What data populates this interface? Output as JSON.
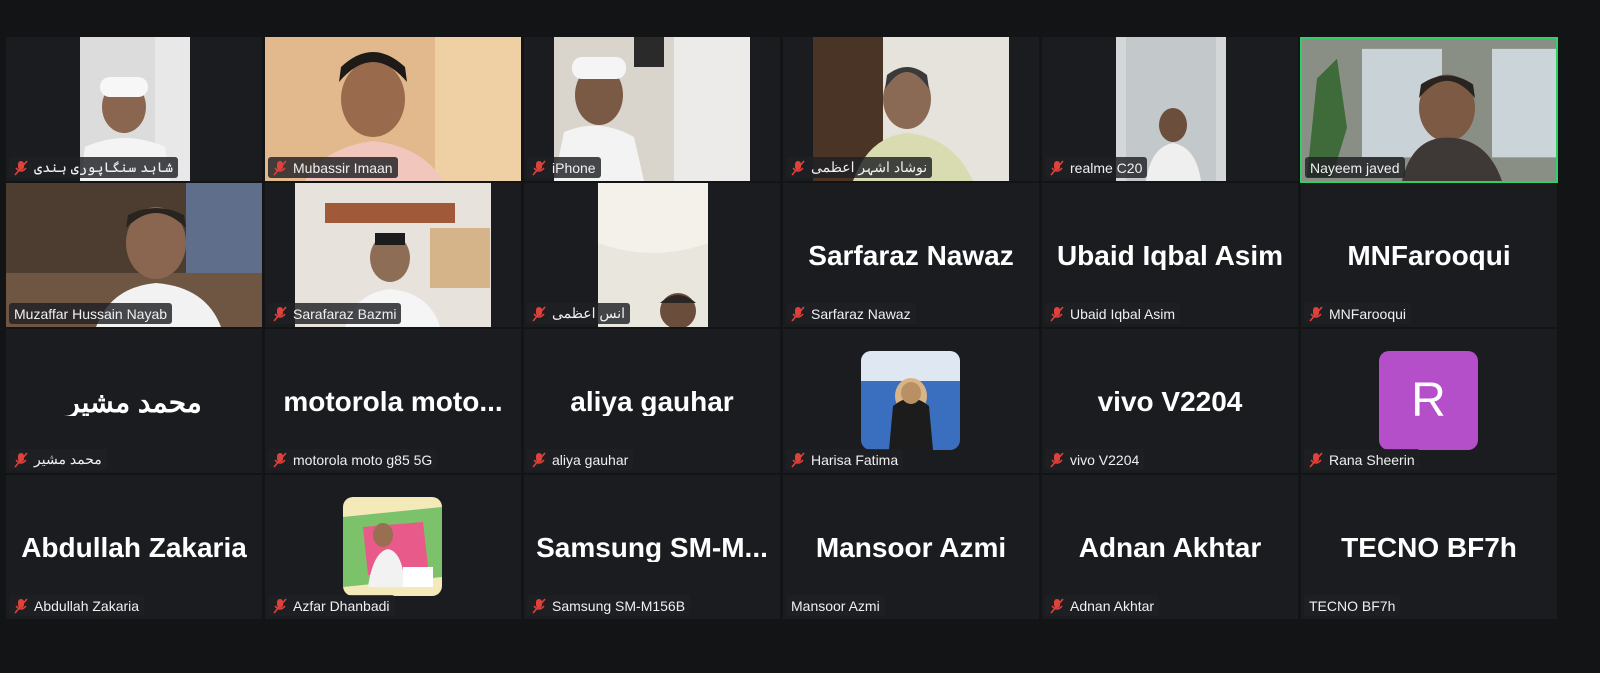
{
  "participants": [
    {
      "name": "شاہد سنگاپوری ہندی",
      "muted": true
    },
    {
      "name": "Mubassir Imaan",
      "muted": true
    },
    {
      "name": "iPhone",
      "muted": true
    },
    {
      "name": "نوشاد اشہر اعظمی",
      "muted": true
    },
    {
      "name": "realme C20",
      "muted": true
    },
    {
      "name": "Nayeem javed",
      "muted": false,
      "active_speaker": true
    },
    {
      "name": "Muzaffar Hussain Nayab",
      "muted": false
    },
    {
      "name": "Sarafaraz Bazmi",
      "muted": true
    },
    {
      "name": "انس اعظمی",
      "muted": true
    },
    {
      "name": "Sarfaraz Nawaz",
      "display": "Sarfaraz Nawaz",
      "muted": true
    },
    {
      "name": "Ubaid Iqbal Asim",
      "display": "Ubaid Iqbal Asim",
      "muted": true
    },
    {
      "name": "MNFarooqui",
      "display": "MNFarooqui",
      "muted": true
    },
    {
      "name": "محمد مشیر",
      "display": "محمد مشیر",
      "muted": true
    },
    {
      "name": "motorola moto g85 5G",
      "display": "motorola  moto...",
      "muted": true
    },
    {
      "name": "aliya gauhar",
      "display": "aliya gauhar",
      "muted": true
    },
    {
      "name": "Harisa Fatima",
      "muted": true,
      "avatar": "profile-photo"
    },
    {
      "name": "vivo V2204",
      "display": "vivo V2204",
      "muted": true
    },
    {
      "name": "Rana Sheerin",
      "muted": true,
      "letter": "R",
      "letter_color": "#b44ec9"
    },
    {
      "name": "Abdullah Zakaria",
      "display": "Abdullah Zakaria",
      "muted": true
    },
    {
      "name": "Azfar Dhanbadi",
      "muted": true,
      "avatar": "profile-photo"
    },
    {
      "name": "Samsung SM-M156B",
      "display": "Samsung  SM-M...",
      "muted": true
    },
    {
      "name": "Mansoor Azmi",
      "display": "Mansoor Azmi",
      "muted": false
    },
    {
      "name": "Adnan Akhtar",
      "display": "Adnan Akhtar",
      "muted": true
    },
    {
      "name": "TECNO BF7h",
      "display": "TECNO BF7h",
      "muted": false
    }
  ],
  "colors": {
    "active_border": "#2fd06a",
    "muted_icon": "#e0413b",
    "background": "#121416"
  }
}
